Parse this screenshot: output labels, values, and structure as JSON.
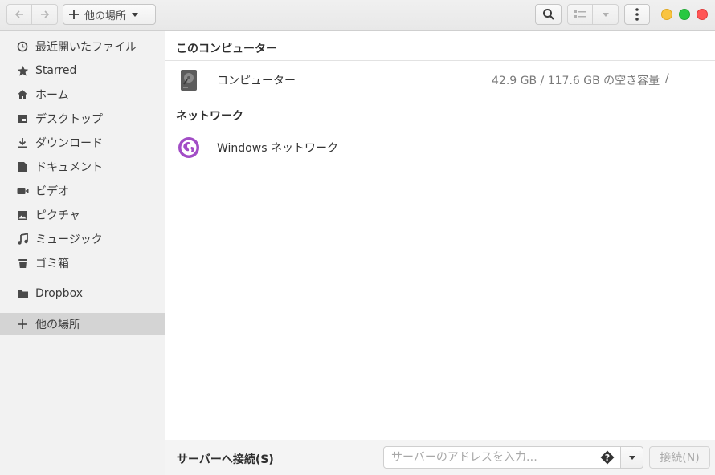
{
  "header": {
    "location_label": "他の場所"
  },
  "sidebar": {
    "items": [
      {
        "label": "最近開いたファイル",
        "icon": "clock-icon"
      },
      {
        "label": "Starred",
        "icon": "star-icon"
      },
      {
        "label": "ホーム",
        "icon": "home-icon"
      },
      {
        "label": "デスクトップ",
        "icon": "desktop-icon"
      },
      {
        "label": "ダウンロード",
        "icon": "download-icon"
      },
      {
        "label": "ドキュメント",
        "icon": "document-icon"
      },
      {
        "label": "ビデオ",
        "icon": "video-icon"
      },
      {
        "label": "ピクチャ",
        "icon": "picture-icon"
      },
      {
        "label": "ミュージック",
        "icon": "music-icon"
      },
      {
        "label": "ゴミ箱",
        "icon": "trash-icon"
      },
      {
        "label": "Dropbox",
        "icon": "folder-icon"
      },
      {
        "label": "他の場所",
        "icon": "plus-icon"
      }
    ],
    "active_index": 11
  },
  "main": {
    "sections": [
      {
        "title": "このコンピューター",
        "rows": [
          {
            "label": "コンピューター",
            "capacity": "42.9 GB / 117.6 GB の空き容量",
            "mount": "/",
            "icon": "drive-icon"
          }
        ]
      },
      {
        "title": "ネットワーク",
        "rows": [
          {
            "label": "Windows ネットワーク",
            "icon": "network-globe-icon"
          }
        ]
      }
    ]
  },
  "bottom": {
    "connect_label": "サーバーへ接続(S)",
    "server_placeholder": "サーバーのアドレスを入力…",
    "connect_button": "接続(N)"
  },
  "colors": {
    "accent_network": "#a24dc6",
    "sidebar_bg": "#f2f2f2",
    "sidebar_active": "#d4d4d4",
    "minimize": "#f9c440",
    "maximize": "#28c840",
    "close": "#ff5555"
  }
}
